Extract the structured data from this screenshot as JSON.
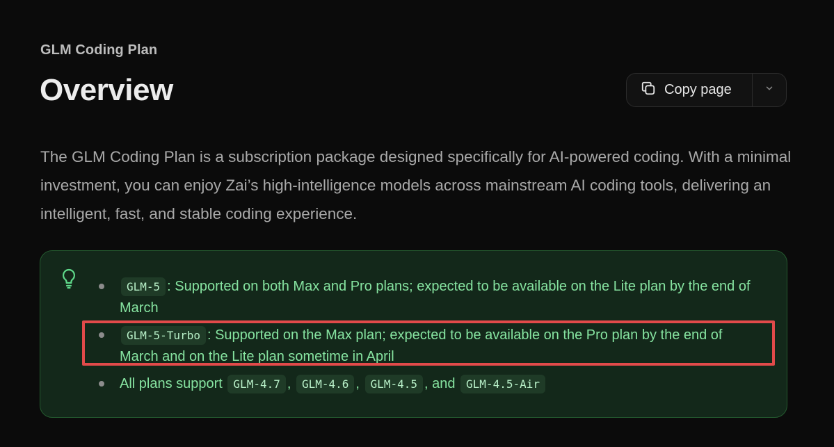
{
  "header": {
    "eyebrow": "GLM Coding Plan",
    "title": "Overview",
    "copy_label": "Copy page",
    "copy_icon": "copy-icon",
    "menu_icon": "chevron-down-icon"
  },
  "intro": "The GLM Coding Plan is a subscription package designed specifically for AI-powered coding. With a minimal investment, you can enjoy Zai’s high-intelligence models across mainstream AI coding tools, delivering an intelligent, fast, and stable coding experience.",
  "callout": {
    "icon": "lightbulb-icon",
    "items": [
      {
        "code": "GLM-5",
        "text": ": Supported on both Max and Pro plans; expected to be available on the Lite plan by the end of March"
      },
      {
        "code": "GLM-5-Turbo",
        "text": ": Supported on the Max plan; expected to be available on the Pro plan by the end of March and on the Lite plan sometime in April"
      },
      {
        "prefix": "All plans support ",
        "codes": [
          "GLM-4.7",
          "GLM-4.6",
          "GLM-4.5",
          "GLM-4.5-Air"
        ],
        "separators": [
          ",",
          ",",
          ", and"
        ]
      }
    ]
  },
  "colors": {
    "background": "#0b0b0b",
    "callout_bg": "#13281a",
    "callout_text": "#86e3a0",
    "highlight": "#e24a4a"
  }
}
